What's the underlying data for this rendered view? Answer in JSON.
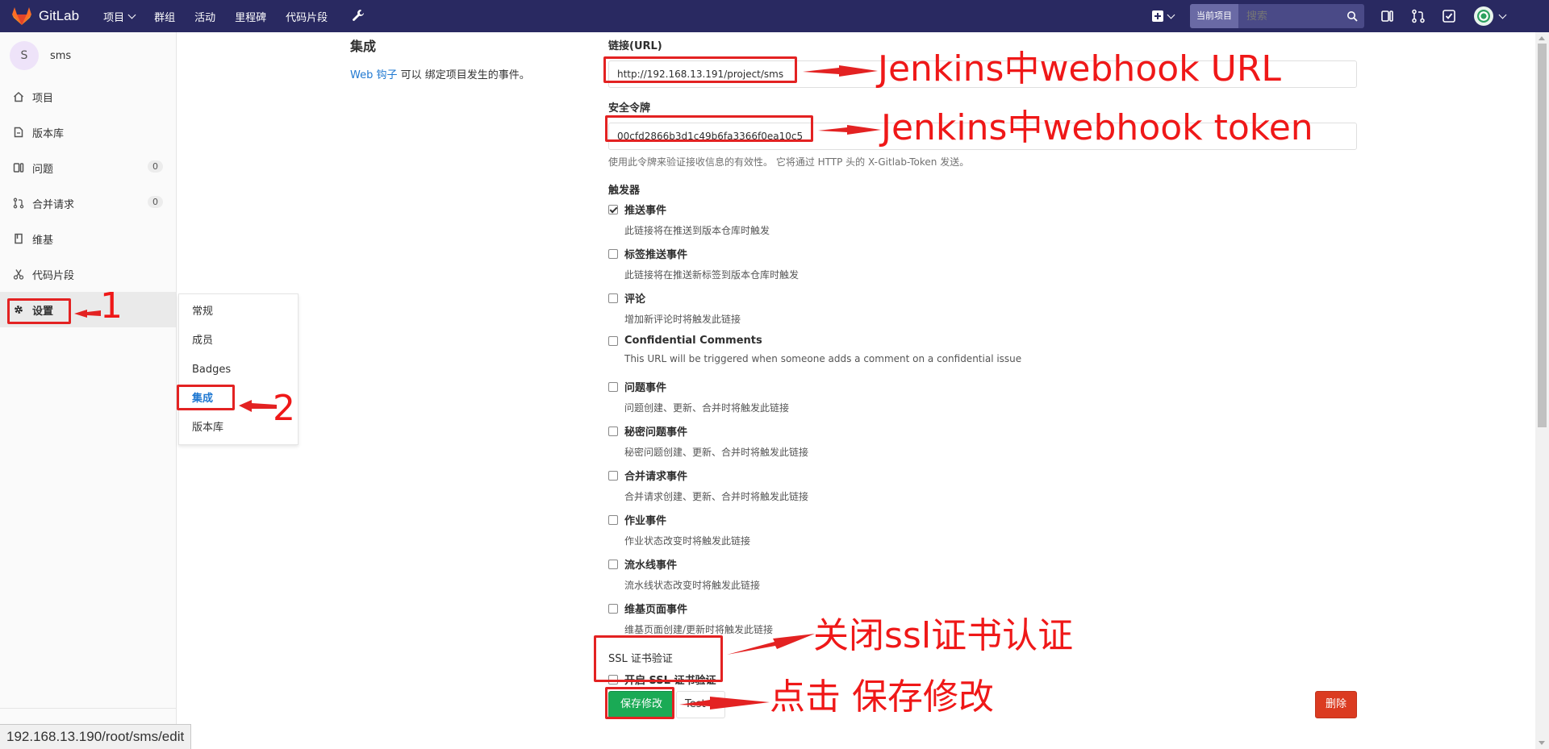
{
  "navbar": {
    "brand": "GitLab",
    "links": [
      "项目",
      "群组",
      "活动",
      "里程碑",
      "代码片段"
    ],
    "search_scope": "当前项目",
    "search_placeholder": "搜索"
  },
  "sidebar": {
    "project_initial": "S",
    "project_name": "sms",
    "items": [
      {
        "label": "项目",
        "icon": "home-icon"
      },
      {
        "label": "版本库",
        "icon": "doc-icon"
      },
      {
        "label": "问题",
        "icon": "issues-icon",
        "count": "0"
      },
      {
        "label": "合并请求",
        "icon": "merge-request-icon",
        "count": "0"
      },
      {
        "label": "维基",
        "icon": "book-icon"
      },
      {
        "label": "代码片段",
        "icon": "scissors-icon"
      },
      {
        "label": "设置",
        "icon": "gear-icon"
      }
    ],
    "settings_submenu": [
      "常规",
      "成员",
      "Badges",
      "集成",
      "版本库"
    ]
  },
  "main": {
    "title": "集成",
    "desc_link": "Web 钩子",
    "desc_rest": " 可以 绑定项目发生的事件。"
  },
  "form": {
    "url_label": "链接(URL)",
    "url_value": "http://192.168.13.191/project/sms",
    "token_label": "安全令牌",
    "token_value": "00cfd2866b3d1c49b6fa3366f0ea10c5",
    "token_help": "使用此令牌来验证接收信息的有效性。 它将通过 HTTP 头的 X-Gitlab-Token 发送。",
    "triggers_label": "触发器",
    "triggers": [
      {
        "label": "推送事件",
        "help": "此链接将在推送到版本仓库时触发",
        "checked": true
      },
      {
        "label": "标签推送事件",
        "help": "此链接将在推送新标签到版本仓库时触发",
        "checked": false
      },
      {
        "label": "评论",
        "help": "增加新评论时将触发此链接",
        "checked": false
      },
      {
        "label": "Confidential Comments",
        "help": "This URL will be triggered when someone adds a comment on a confidential issue",
        "checked": false
      },
      {
        "label": "问题事件",
        "help": "问题创建、更新、合并时将触发此链接",
        "checked": false
      },
      {
        "label": "秘密问题事件",
        "help": "秘密问题创建、更新、合并时将触发此链接",
        "checked": false
      },
      {
        "label": "合并请求事件",
        "help": "合并请求创建、更新、合并时将触发此链接",
        "checked": false
      },
      {
        "label": "作业事件",
        "help": "作业状态改变时将触发此链接",
        "checked": false
      },
      {
        "label": "流水线事件",
        "help": "流水线状态改变时将触发此链接",
        "checked": false
      },
      {
        "label": "维基页面事件",
        "help": "维基页面创建/更新时将触发此链接",
        "checked": false
      }
    ],
    "ssl_label": "SSL 证书验证",
    "ssl_checkbox_label": "开启 SSL 证书验证",
    "ssl_checked": false,
    "save_label": "保存修改",
    "test_label": "Test",
    "delete_label": "删除"
  },
  "status_url": "192.168.13.190/root/sms/edit",
  "annotations": {
    "num1": "1",
    "num2": "2",
    "url_note": "Jenkins中webhook URL",
    "token_note": "Jenkins中webhook token",
    "ssl_note": "关闭ssl证书认证",
    "save_note": "点击 保存修改"
  },
  "colors": {
    "navbar": "#292961",
    "annotation": "#e32222",
    "save": "#1aaa55",
    "delete": "#db3b21",
    "link": "#1f78d1"
  }
}
